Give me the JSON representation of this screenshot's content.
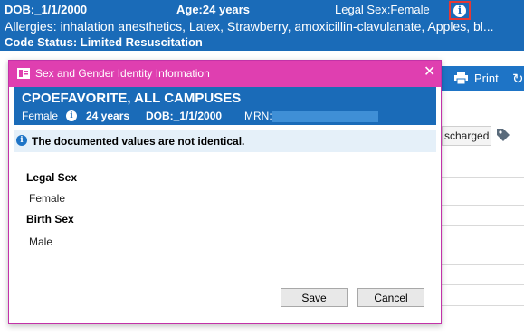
{
  "banner": {
    "dob": "DOB:_1/1/2000",
    "age": "Age:24 years",
    "legal_sex": "Legal Sex:Female",
    "allergies": "Allergies: inhalation anesthetics, Latex, Strawberry, amoxicillin-clavulanate, Apples, bl...",
    "code_status": "Code Status: Limited Resuscitation",
    "info_icon": "info-icon"
  },
  "toolbar": {
    "print_label": "Print",
    "print_icon": "printer-icon",
    "refresh_icon": "refresh-icon"
  },
  "background": {
    "discharged_label": "scharged",
    "tag_icon": "tag-icon"
  },
  "dialog": {
    "title": "Sex and Gender Identity Information",
    "close_glyph": "✕",
    "patient": {
      "name": "CPOEFAVORITE, ALL CAMPUSES",
      "sex": "Female",
      "age": "24 years",
      "dob": "DOB:_1/1/2000",
      "mrn_label": "MRN:"
    },
    "notice": "The documented values are not identical.",
    "fields": [
      {
        "label": "Legal Sex",
        "value": "Female"
      },
      {
        "label": "Birth Sex",
        "value": "Male"
      }
    ],
    "save_label": "Save",
    "cancel_label": "Cancel"
  },
  "colors": {
    "banner_blue": "#1a6bb8",
    "title_magenta": "#df3fb0",
    "highlight_red": "#e53935",
    "notice_bg": "#e5f0f9"
  }
}
